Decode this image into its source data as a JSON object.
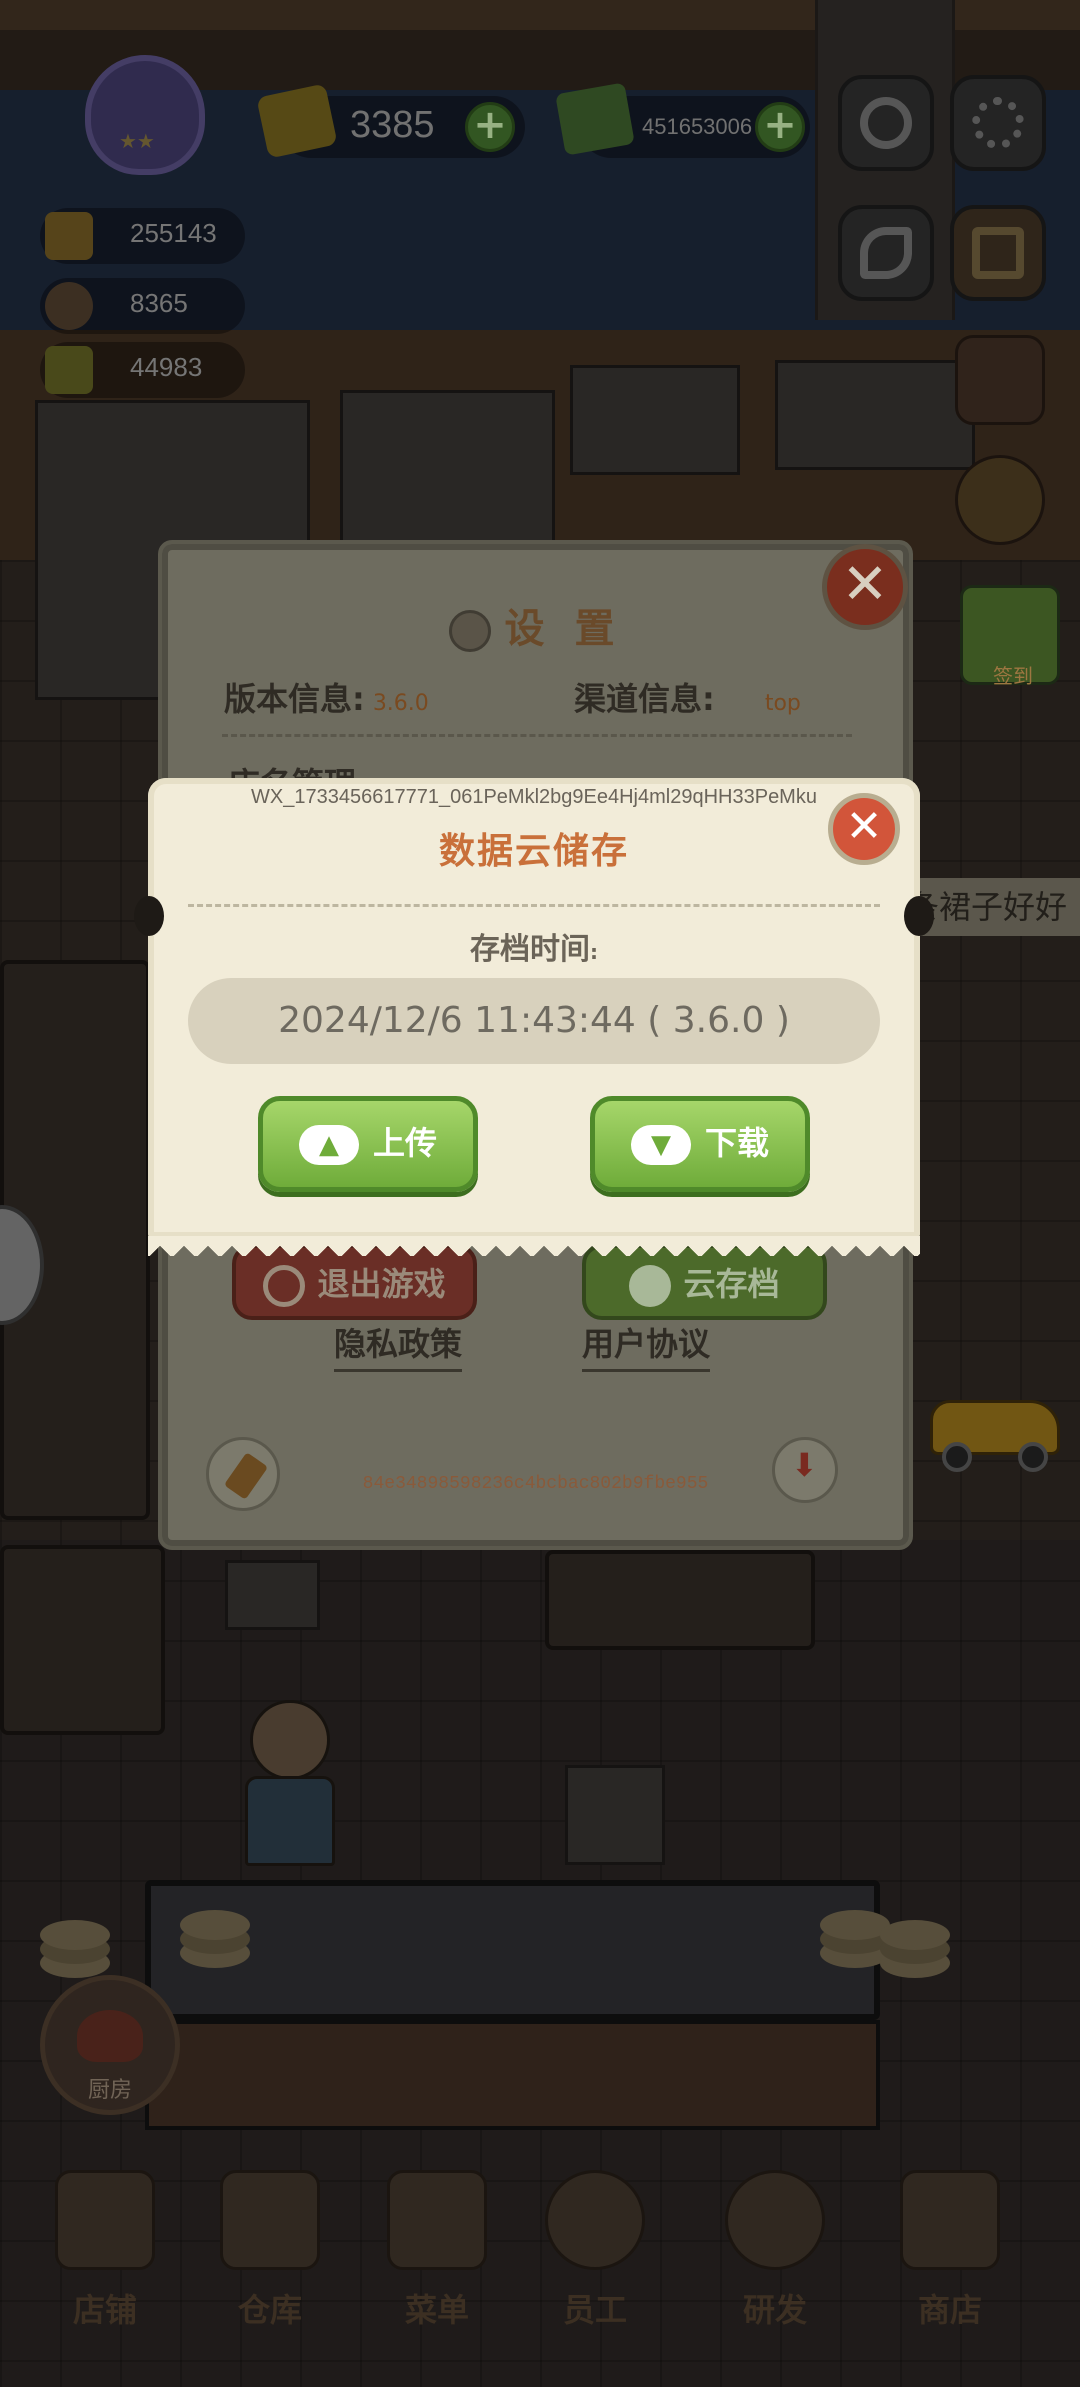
{
  "hud": {
    "gold": "3385",
    "cash": "451653006",
    "stats": [
      "255143",
      "8365",
      "44983"
    ]
  },
  "speech_bubble": "条裙子好好",
  "sign_in_label": "签到",
  "kitchen_label": "厨房",
  "settings": {
    "title": "设 置",
    "version_label": "版本信息:",
    "version_value": "3.6.0",
    "channel_label": "渠道信息:",
    "channel_value": "top",
    "shop_management": "店名管理",
    "exit_button": "退出游戏",
    "cloud_save_button": "云存档",
    "privacy_link": "隐私政策",
    "agreement_link": "用户协议",
    "device_hash": "84e34898598236c4bcbac802b9fbe955",
    "close": "✕"
  },
  "cloud_dialog": {
    "user_id": "WX_1733456617771_061PeMkl2bg9Ee4Hj4ml29qHH33PeMku",
    "title": "数据云储存",
    "save_time_label": "存档时间",
    "save_time_colon": ":",
    "save_time_value": "2024/12/6 11:43:44 ( 3.6.0 )",
    "upload_button": "上传",
    "download_button": "下载",
    "close": "✕"
  },
  "bottom_nav": [
    {
      "label": "店铺"
    },
    {
      "label": "仓库"
    },
    {
      "label": "菜单"
    },
    {
      "label": "员工"
    },
    {
      "label": "研发"
    },
    {
      "label": "商店"
    }
  ]
}
